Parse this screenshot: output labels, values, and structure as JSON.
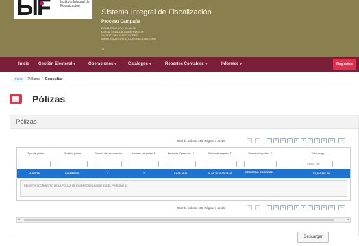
{
  "header": {
    "logo_text": "ЬІF",
    "logo_caption": "Instituto Integral de Fiscalización",
    "title": "Sistema Integral de Fiscalización",
    "subtitle": "Proceso Campaña",
    "info_lines": [
      "FVEM-PR-NUEVA ALIANZA",
      "LOCAL SINALOA-GOBERNADOR I",
      "SUJETO OBLIGADO COPPEL",
      "IDENTIFICADOR DE CONTABILIDAD: 0000"
    ],
    "dot": "a"
  },
  "nav": {
    "items": [
      {
        "label": "Inicio",
        "caret": ""
      },
      {
        "label": "Gestión Electoral",
        "caret": "▾"
      },
      {
        "label": "Operaciones",
        "caret": "▾"
      },
      {
        "label": "Catálogos",
        "caret": "▾"
      },
      {
        "label": "Reportes Contables",
        "caret": "▾"
      },
      {
        "label": "Informes",
        "caret": "▾"
      }
    ],
    "report_button": "Reportes"
  },
  "breadcrumb": {
    "items": [
      "Inicio",
      "Pólizas",
      "Consultar"
    ],
    "separator": "/"
  },
  "page_title": "Pólizas",
  "panel": {
    "title": "Pólizas"
  },
  "pager": {
    "summary": "Total de pólizas: 106. Página: 1 de 14",
    "first": "«",
    "prev": "‹",
    "pages": [
      "1",
      "2",
      "3",
      "4",
      "5",
      "6",
      "7",
      "8",
      "9",
      "10"
    ],
    "next": ">>"
  },
  "table": {
    "columns": [
      {
        "label": "Tipo de póliza",
        "sort": ""
      },
      {
        "label": "Subtipo póliza",
        "sort": ""
      },
      {
        "label": "Periodo de la operación",
        "sort": ""
      },
      {
        "label": "Número de póliza",
        "sort": "⇕"
      },
      {
        "label": "Fecha de Operación",
        "sort": "⇕"
      },
      {
        "label": "Fecha de registro",
        "sort": "⇕"
      },
      {
        "label": "Descripción póliza",
        "sort": "⇕"
      },
      {
        "label": "Total cargo",
        "sort": ""
      }
    ],
    "filters": [
      "",
      "",
      "",
      "",
      "",
      "",
      "",
      "Cargo ‑ Ab"
    ],
    "row": [
      "AJUSTE",
      "INGRESOS",
      "2",
      "7",
      "01-06-2016",
      "16-06-2016 20:17:00",
      "REGISTRO CORRECT...",
      "$1,102,661.00"
    ],
    "detail": "REGISTRO CORRECTO DE LA PÓLIZA DE INGRESOS NÚMERO 11 DEL PERIODO 02"
  },
  "scroll": {
    "left": "◂",
    "right": "▸"
  },
  "download_label": "Descargar"
}
